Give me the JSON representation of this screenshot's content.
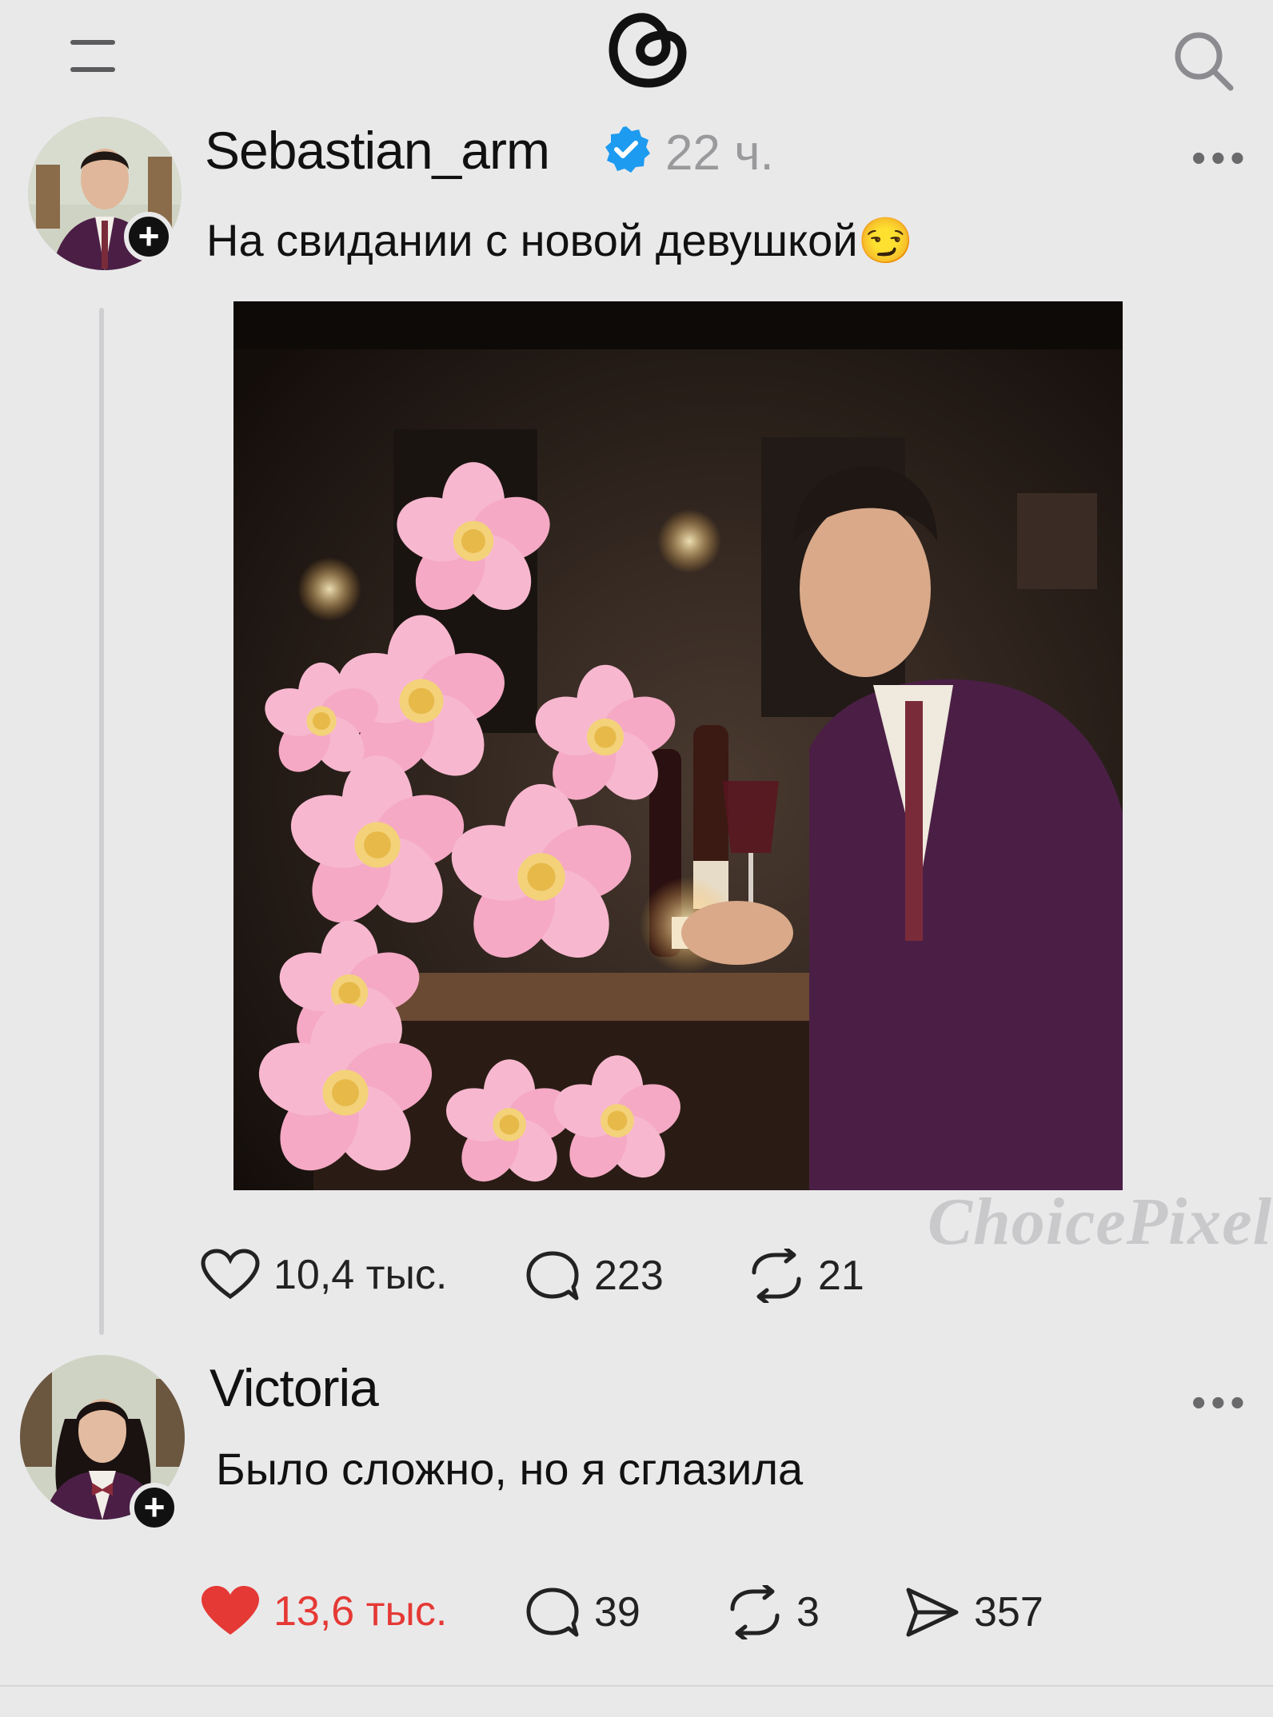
{
  "header": {
    "menu_icon": "menu-icon",
    "logo_icon": "threads-logo-icon",
    "search_icon": "search-icon"
  },
  "post": {
    "username": "Sebastian_arm",
    "verified_icon": "verified-badge-icon",
    "time": "22 ч.",
    "caption": "На свидании с новой девушкой😏",
    "more": "•••",
    "stats": {
      "likes": "10,4 тыс.",
      "comments": "223",
      "reposts": "21"
    }
  },
  "watermark": "ChoicePixel",
  "reply": {
    "username": "Victoria",
    "text": "Было сложно, но я сглазила",
    "more": "•••",
    "stats": {
      "likes": "13,6 тыс.",
      "comments": "39",
      "reposts": "3",
      "shares": "357"
    }
  },
  "colors": {
    "background": "#e9e9ea",
    "liked": "#e53935",
    "verified": "#1d9bf0",
    "jacket": "#4b1f45"
  }
}
